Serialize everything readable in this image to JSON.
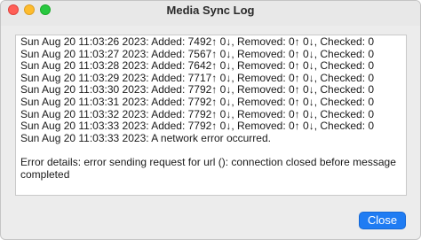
{
  "window": {
    "title": "Media Sync Log"
  },
  "log": {
    "lines": [
      "Sun Aug 20 11:03:26 2023: Added: 7492↑ 0↓, Removed: 0↑ 0↓, Checked: 0",
      "Sun Aug 20 11:03:27 2023: Added: 7567↑ 0↓, Removed: 0↑ 0↓, Checked: 0",
      "Sun Aug 20 11:03:28 2023: Added: 7642↑ 0↓, Removed: 0↑ 0↓, Checked: 0",
      "Sun Aug 20 11:03:29 2023: Added: 7717↑ 0↓, Removed: 0↑ 0↓, Checked: 0",
      "Sun Aug 20 11:03:30 2023: Added: 7792↑ 0↓, Removed: 0↑ 0↓, Checked: 0",
      "Sun Aug 20 11:03:31 2023: Added: 7792↑ 0↓, Removed: 0↑ 0↓, Checked: 0",
      "Sun Aug 20 11:03:32 2023: Added: 7792↑ 0↓, Removed: 0↑ 0↓, Checked: 0",
      "Sun Aug 20 11:03:33 2023: Added: 7792↑ 0↓, Removed: 0↑ 0↓, Checked: 0",
      "Sun Aug 20 11:03:33 2023: A network error occurred."
    ],
    "error_details": "Error details: error sending request for url (): connection closed before message completed"
  },
  "footer": {
    "close_label": "Close"
  },
  "colors": {
    "accent": "#1f7cf3",
    "close_dot": "#ff5f57",
    "minimize_dot": "#febc2e",
    "zoom_dot": "#28c840"
  }
}
